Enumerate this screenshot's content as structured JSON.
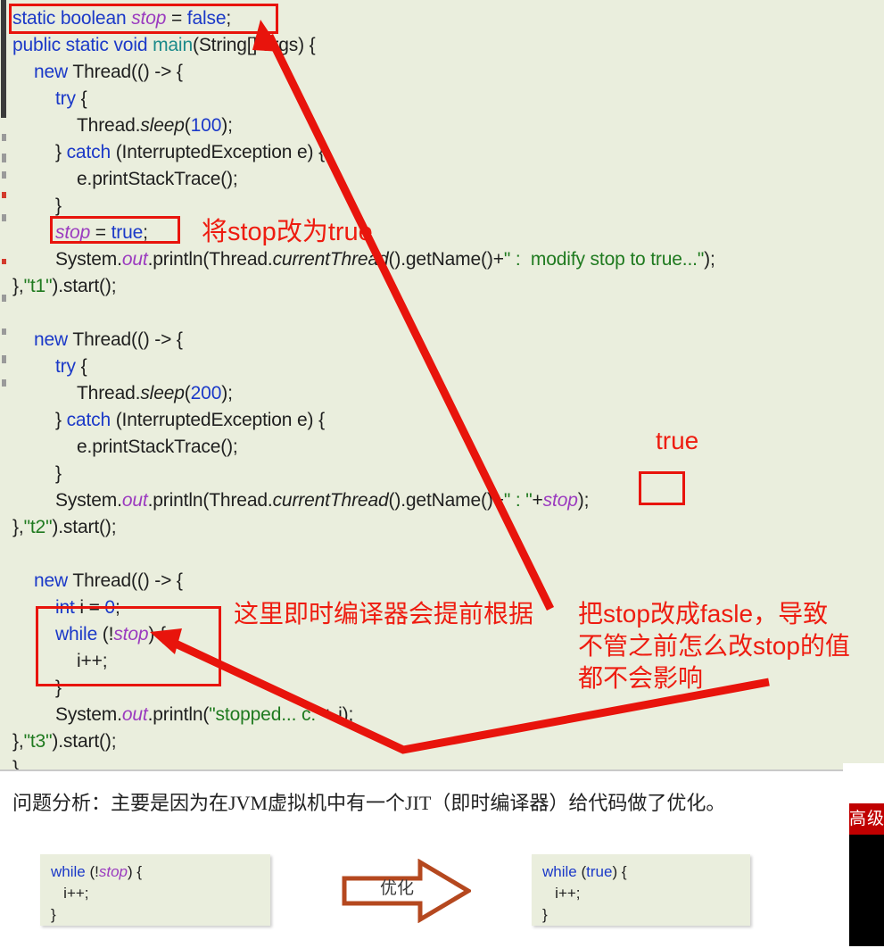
{
  "editor": {
    "background_color": "#eaeedd",
    "lines": [
      {
        "id": "l1",
        "indent": 0,
        "tokens": [
          {
            "t": "static ",
            "c": "kw"
          },
          {
            "t": "boolean ",
            "c": "kw"
          },
          {
            "t": "stop",
            "c": "fld"
          },
          {
            "t": " = ",
            "c": "pl"
          },
          {
            "t": "false",
            "c": "kw"
          },
          {
            "t": ";",
            "c": "pl"
          }
        ]
      },
      {
        "id": "l2",
        "indent": 0,
        "tokens": [
          {
            "t": "public static void ",
            "c": "kw"
          },
          {
            "t": "main",
            "c": "mth"
          },
          {
            "t": "(String[] args) {",
            "c": "pl"
          }
        ]
      },
      {
        "id": "l3",
        "indent": 1,
        "tokens": [
          {
            "t": "new ",
            "c": "kw"
          },
          {
            "t": "Thread(() -> {",
            "c": "pl"
          }
        ]
      },
      {
        "id": "l4",
        "indent": 2,
        "tokens": [
          {
            "t": "try ",
            "c": "kw"
          },
          {
            "t": "{",
            "c": "pl"
          }
        ]
      },
      {
        "id": "l5",
        "indent": 3,
        "tokens": [
          {
            "t": "Thread.",
            "c": "pl"
          },
          {
            "t": "sleep",
            "c": "itl"
          },
          {
            "t": "(",
            "c": "pl"
          },
          {
            "t": "100",
            "c": "num"
          },
          {
            "t": ");",
            "c": "pl"
          }
        ]
      },
      {
        "id": "l6",
        "indent": 2,
        "tokens": [
          {
            "t": "} ",
            "c": "pl"
          },
          {
            "t": "catch ",
            "c": "kw"
          },
          {
            "t": "(InterruptedException e) {",
            "c": "pl"
          }
        ]
      },
      {
        "id": "l7",
        "indent": 3,
        "tokens": [
          {
            "t": "e.printStackTrace();",
            "c": "pl"
          }
        ]
      },
      {
        "id": "l8",
        "indent": 2,
        "tokens": [
          {
            "t": "}",
            "c": "pl"
          }
        ]
      },
      {
        "id": "l9",
        "indent": 2,
        "tokens": [
          {
            "t": "stop",
            "c": "fld"
          },
          {
            "t": " = ",
            "c": "pl"
          },
          {
            "t": "true",
            "c": "kw"
          },
          {
            "t": ";",
            "c": "pl"
          }
        ]
      },
      {
        "id": "l10",
        "indent": 2,
        "tokens": [
          {
            "t": "System.",
            "c": "pl"
          },
          {
            "t": "out",
            "c": "fld"
          },
          {
            "t": ".println(Thread.",
            "c": "pl"
          },
          {
            "t": "currentThread",
            "c": "itl"
          },
          {
            "t": "().getName()+",
            "c": "pl"
          },
          {
            "t": "\" :  modify stop to true...\"",
            "c": "str"
          },
          {
            "t": ");",
            "c": "pl"
          }
        ]
      },
      {
        "id": "l11",
        "indent": 0,
        "tokens": [
          {
            "t": "},",
            "c": "pl"
          },
          {
            "t": "\"t1\"",
            "c": "str"
          },
          {
            "t": ").start();",
            "c": "pl"
          }
        ]
      },
      {
        "id": "l12",
        "indent": 0,
        "tokens": [
          {
            "t": "",
            "c": "pl"
          }
        ]
      },
      {
        "id": "l13",
        "indent": 1,
        "tokens": [
          {
            "t": "new ",
            "c": "kw"
          },
          {
            "t": "Thread(() -> {",
            "c": "pl"
          }
        ]
      },
      {
        "id": "l14",
        "indent": 2,
        "tokens": [
          {
            "t": "try ",
            "c": "kw"
          },
          {
            "t": "{",
            "c": "pl"
          }
        ]
      },
      {
        "id": "l15",
        "indent": 3,
        "tokens": [
          {
            "t": "Thread.",
            "c": "pl"
          },
          {
            "t": "sleep",
            "c": "itl"
          },
          {
            "t": "(",
            "c": "pl"
          },
          {
            "t": "200",
            "c": "num"
          },
          {
            "t": ");",
            "c": "pl"
          }
        ]
      },
      {
        "id": "l16",
        "indent": 2,
        "tokens": [
          {
            "t": "} ",
            "c": "pl"
          },
          {
            "t": "catch ",
            "c": "kw"
          },
          {
            "t": "(InterruptedException e) {",
            "c": "pl"
          }
        ]
      },
      {
        "id": "l17",
        "indent": 3,
        "tokens": [
          {
            "t": "e.printStackTrace();",
            "c": "pl"
          }
        ]
      },
      {
        "id": "l18",
        "indent": 2,
        "tokens": [
          {
            "t": "}",
            "c": "pl"
          }
        ]
      },
      {
        "id": "l19",
        "indent": 2,
        "tokens": [
          {
            "t": "System.",
            "c": "pl"
          },
          {
            "t": "out",
            "c": "fld"
          },
          {
            "t": ".println(Thread.",
            "c": "pl"
          },
          {
            "t": "currentThread",
            "c": "itl"
          },
          {
            "t": "().getName()+",
            "c": "pl"
          },
          {
            "t": "\" : \"",
            "c": "str"
          },
          {
            "t": "+",
            "c": "pl"
          },
          {
            "t": "stop",
            "c": "fld"
          },
          {
            "t": ");",
            "c": "pl"
          }
        ]
      },
      {
        "id": "l20",
        "indent": 0,
        "tokens": [
          {
            "t": "},",
            "c": "pl"
          },
          {
            "t": "\"t2\"",
            "c": "str"
          },
          {
            "t": ").start();",
            "c": "pl"
          }
        ]
      },
      {
        "id": "l21",
        "indent": 0,
        "tokens": [
          {
            "t": "",
            "c": "pl"
          }
        ]
      },
      {
        "id": "l22",
        "indent": 1,
        "tokens": [
          {
            "t": "new ",
            "c": "kw"
          },
          {
            "t": "Thread(() -> {",
            "c": "pl"
          }
        ]
      },
      {
        "id": "l23",
        "indent": 2,
        "tokens": [
          {
            "t": "int ",
            "c": "kw"
          },
          {
            "t": "i = ",
            "c": "pl"
          },
          {
            "t": "0",
            "c": "num"
          },
          {
            "t": ";",
            "c": "pl"
          }
        ]
      },
      {
        "id": "l24",
        "indent": 2,
        "tokens": [
          {
            "t": "while ",
            "c": "kw"
          },
          {
            "t": "(!",
            "c": "pl"
          },
          {
            "t": "stop",
            "c": "fld"
          },
          {
            "t": ") {",
            "c": "pl"
          }
        ]
      },
      {
        "id": "l25",
        "indent": 3,
        "tokens": [
          {
            "t": "i++;",
            "c": "pl"
          }
        ]
      },
      {
        "id": "l26",
        "indent": 2,
        "tokens": [
          {
            "t": "}",
            "c": "pl"
          }
        ]
      },
      {
        "id": "l27",
        "indent": 2,
        "tokens": [
          {
            "t": "System.",
            "c": "pl"
          },
          {
            "t": "out",
            "c": "fld"
          },
          {
            "t": ".println(",
            "c": "pl"
          },
          {
            "t": "\"stopped... c:\"",
            "c": "str"
          },
          {
            "t": "+ i);",
            "c": "pl"
          }
        ]
      },
      {
        "id": "l28",
        "indent": 0,
        "tokens": [
          {
            "t": "},",
            "c": "pl"
          },
          {
            "t": "\"t3\"",
            "c": "str"
          },
          {
            "t": ").start();",
            "c": "pl"
          }
        ]
      },
      {
        "id": "l29",
        "indent": 0,
        "tokens": [
          {
            "t": "}",
            "c": "pl"
          }
        ]
      }
    ]
  },
  "annotations": {
    "color": "#ee1c10",
    "modify_stop": "将stop改为true",
    "true_label": "true",
    "jit_note": "这里即时编译器会提前根据",
    "fasle_note": "把stop改成fasle，导致\n不管之前怎么改stop的值\n都不会影响",
    "boxes": [
      {
        "name": "declaration",
        "target": "static boolean stop = false;"
      },
      {
        "name": "stop-assign",
        "target": "stop = true;"
      },
      {
        "name": "stop-print",
        "target": "stop"
      },
      {
        "name": "while-loop",
        "target": "while (!stop) { i++; }"
      }
    ]
  },
  "analysis": {
    "text": "问题分析：主要是因为在JVM虚拟机中有一个JIT（即时编译器）给代码做了优化。",
    "before_code": "while (!stop) {\n   i++;\n}",
    "after_code": "while (true) {\n   i++;\n}",
    "arrow_label": "优化",
    "before_tokens": [
      {
        "t": "while ",
        "c": "kw"
      },
      {
        "t": "(!",
        "c": "pl"
      },
      {
        "t": "stop",
        "c": "fld"
      },
      {
        "t": ") {",
        "c": "pl"
      },
      {
        "t": "\n   i++;\n}",
        "c": "pl"
      }
    ],
    "after_tokens": [
      {
        "t": "while ",
        "c": "kw"
      },
      {
        "t": "(",
        "c": "pl"
      },
      {
        "t": "true",
        "c": "kw"
      },
      {
        "t": ") {",
        "c": "pl"
      },
      {
        "t": "\n   i++;\n}",
        "c": "pl"
      }
    ]
  },
  "watermark": {
    "badge_text": "高级",
    "badge_color": "#c00000"
  }
}
